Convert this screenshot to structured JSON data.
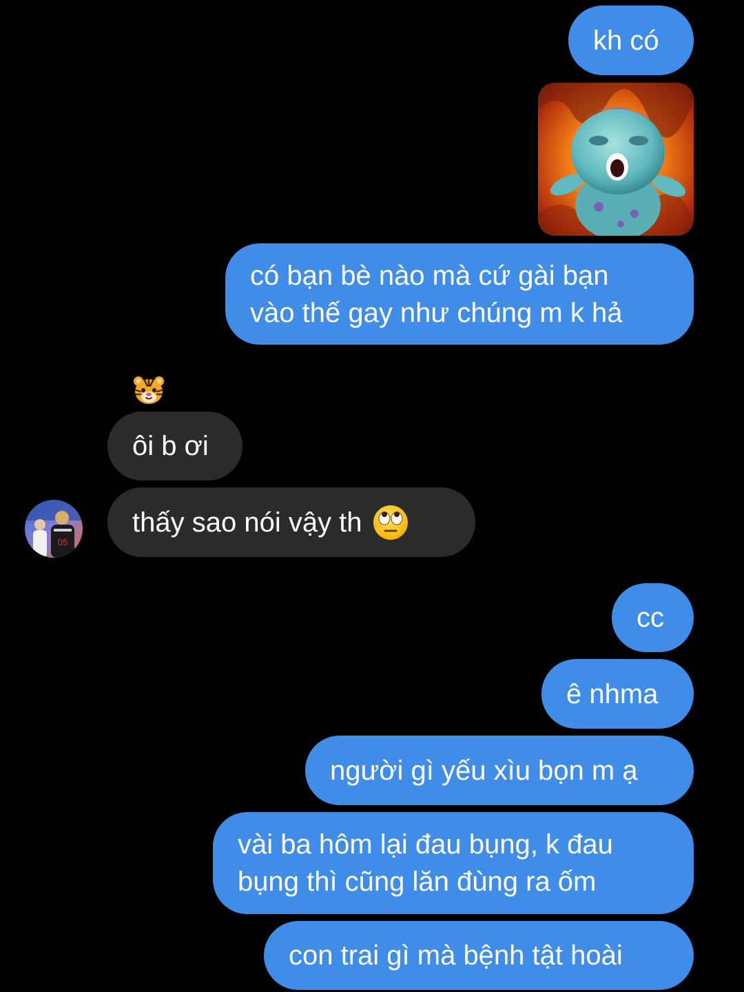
{
  "messages": {
    "m1": "kh có",
    "m3_line1": "có bạn bè nào mà cứ gài bạn",
    "m3_line2": "vào thế gay như chúng m k hả",
    "m4": "ôi b ơi",
    "m5": "thấy sao nói vậy th",
    "m6": "cc",
    "m7": "ê nhma",
    "m8": "người gì yếu xìu bọn m ạ",
    "m9_line1": "vài ba hôm lại đau bụng, k đau",
    "m9_line2": "bụng thì cũng lăn đùng ra ốm",
    "m10": "con trai gì mà bệnh tật hoài"
  },
  "icons": {
    "sticker": "crying-creature-fire-sticker",
    "reaction": "tiger-face-emoji",
    "avatar": "contact-avatar",
    "inline_emoji": "face-with-rolling-eyes-emoji"
  },
  "colors": {
    "background": "#000000",
    "outgoing_bubble": "#3f8de8",
    "incoming_bubble": "#2b2b2b",
    "text": "#ffffff"
  }
}
